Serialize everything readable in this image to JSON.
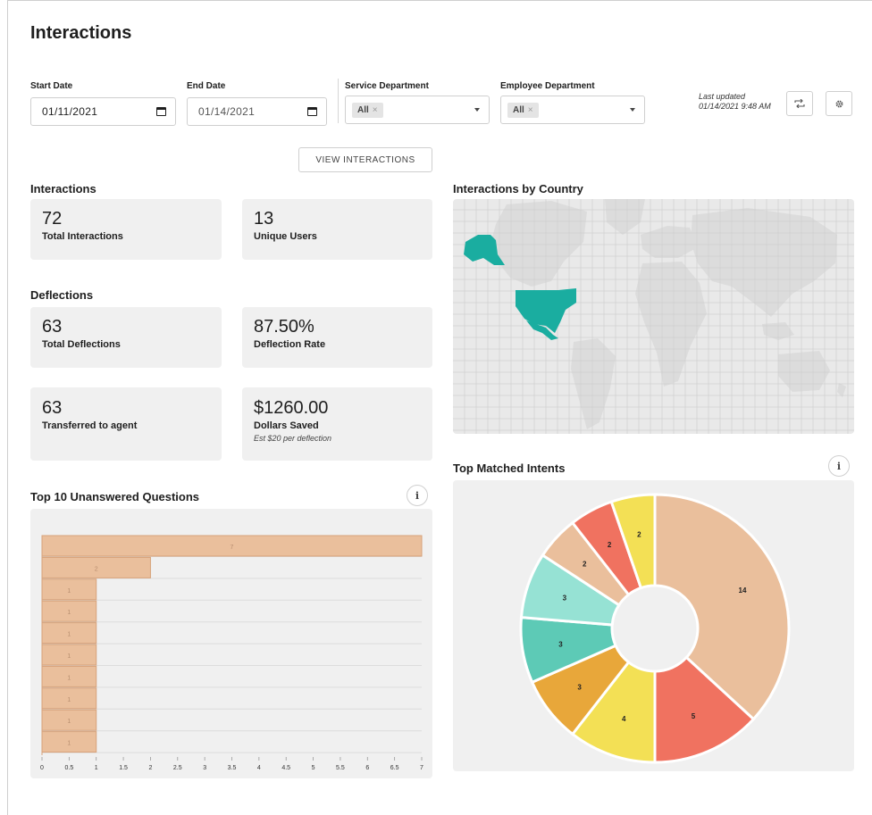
{
  "page": {
    "title": "Interactions"
  },
  "filters": {
    "start_date": {
      "label": "Start Date",
      "value": "01/11/2021"
    },
    "end_date": {
      "label": "End Date",
      "value": "01/14/2021"
    },
    "service_department": {
      "label": "Service Department",
      "chip": "All"
    },
    "employee_department": {
      "label": "Employee Department",
      "chip": "All"
    },
    "last_updated": {
      "label": "Last updated",
      "value": "01/14/2021 9:48 AM"
    },
    "view_button": "VIEW INTERACTIONS",
    "chip_remove": "×"
  },
  "icons": {
    "refresh": "refresh-icon",
    "settings": "gear-icon",
    "calendar": "calendar-icon",
    "info": "info-icon",
    "caret": "chevron-down-icon",
    "info_glyph": "i"
  },
  "interactions": {
    "title": "Interactions",
    "total": {
      "value": "72",
      "label": "Total Interactions"
    },
    "unique": {
      "value": "13",
      "label": "Unique Users"
    }
  },
  "deflections": {
    "title": "Deflections",
    "total": {
      "value": "63",
      "label": "Total Deflections"
    },
    "rate": {
      "value": "87.50%",
      "label": "Deflection Rate"
    },
    "transferred": {
      "value": "63",
      "label": "Transferred to agent"
    },
    "saved": {
      "value": "$1260.00",
      "label": "Dollars Saved",
      "note": "Est $20 per deflection"
    }
  },
  "country_map": {
    "title": "Interactions by Country",
    "highlight_color": "#1aada0"
  },
  "colors": {
    "bar": "#eabf9c",
    "bar_border": "#d7a27a"
  },
  "chart_data": [
    {
      "type": "bar",
      "title": "Top 10 Unanswered Questions",
      "orientation": "horizontal",
      "values": [
        7,
        2,
        1,
        1,
        1,
        1,
        1,
        1,
        1,
        1
      ],
      "xlim": [
        0,
        7
      ],
      "xticks": [
        "0",
        "0.5",
        "1",
        "1.5",
        "2",
        "2.5",
        "3",
        "3.5",
        "4",
        "4.5",
        "5",
        "5.5",
        "6",
        "6.5",
        "7"
      ]
    },
    {
      "type": "pie",
      "title": "Top Matched Intents",
      "donut": true,
      "values": [
        14,
        5,
        4,
        3,
        3,
        3,
        2,
        2,
        2
      ],
      "colors": [
        "#eabf9c",
        "#f07260",
        "#f3e055",
        "#e8a73a",
        "#5dcab6",
        "#96e2d4",
        "#eabf9c",
        "#f07260",
        "#f3e055"
      ]
    }
  ]
}
